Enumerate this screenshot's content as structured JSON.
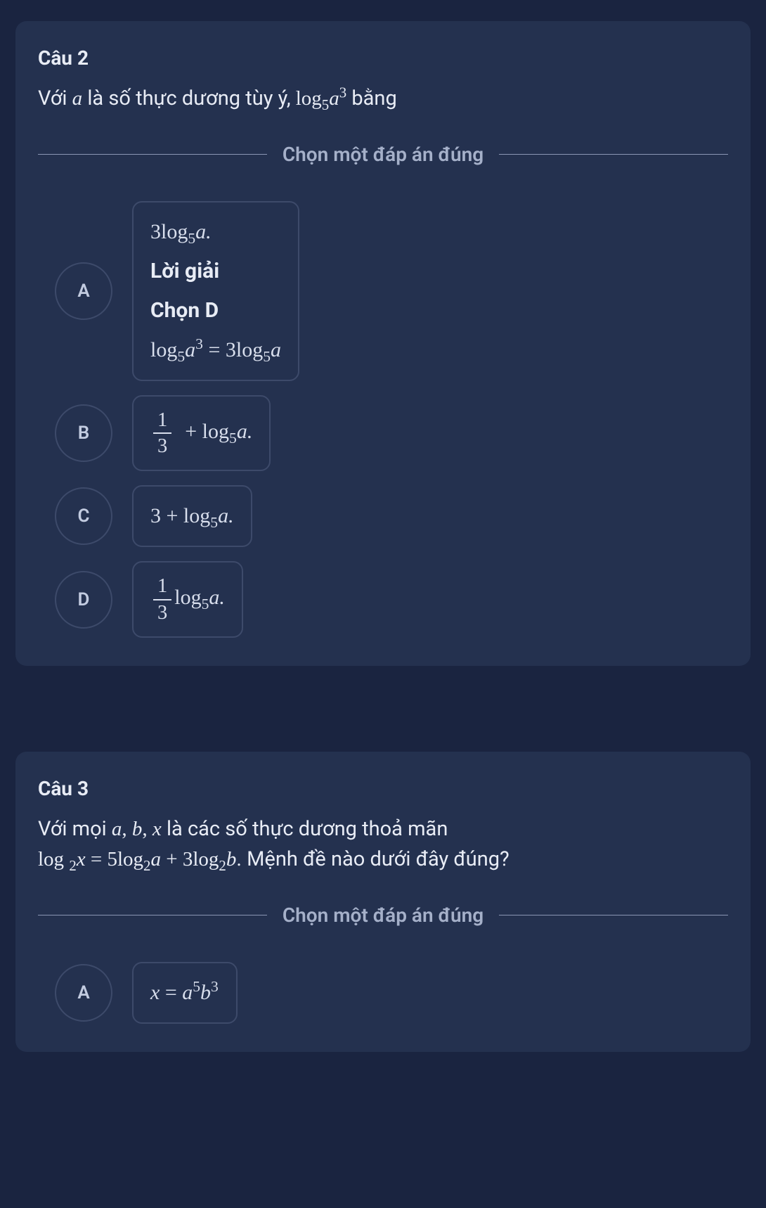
{
  "q2": {
    "title": "Câu 2",
    "text_prefix": "Với ",
    "text_mid": " là số thực dương tùy ý, ",
    "text_suffix": " bằng",
    "divider_label": "Chọn một đáp án đúng",
    "options": {
      "A": {
        "letter": "A",
        "line1_pre": "3",
        "solution_label": "Lời giải",
        "choose_label": "Chọn D"
      },
      "B": {
        "letter": "B"
      },
      "C": {
        "letter": "C"
      },
      "D": {
        "letter": "D"
      }
    }
  },
  "q3": {
    "title": "Câu 3",
    "text_prefix": "Với mọi ",
    "text_mid": " là các số thực dương thoả mãn",
    "text_suffix": ". Mệnh đề nào dưới đây đúng?",
    "divider_label": "Chọn một đáp án đúng",
    "options": {
      "A": {
        "letter": "A"
      }
    }
  }
}
